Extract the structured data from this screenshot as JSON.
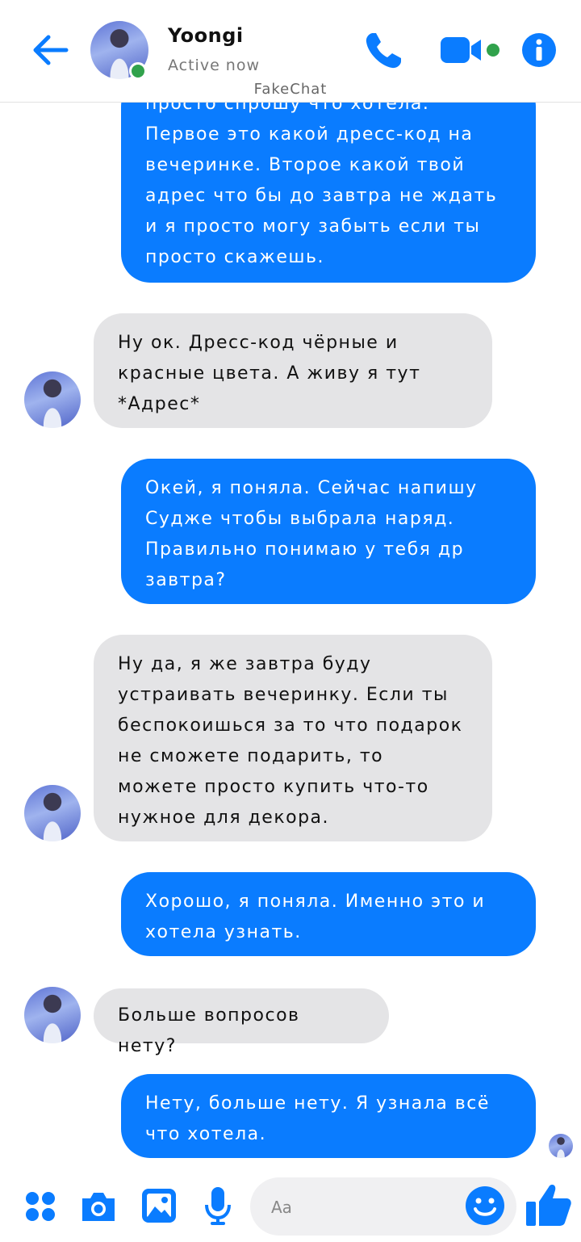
{
  "header": {
    "contact_name": "Yoongi",
    "status": "Active now",
    "watermark": "FakeChat",
    "icons": [
      "back-arrow-icon",
      "phone-icon",
      "video-camera-icon",
      "info-icon"
    ]
  },
  "messages": [
    {
      "from": "me",
      "text": "просто спрошу что хотела.\nПервое это какой дресс-код на вечеринке. Второе какой твой адрес что бы до завтра не ждать и я просто могу забыть если ты просто скажешь."
    },
    {
      "from": "them",
      "text": "Ну ок. Дресс-код чёрные и красные цвета. А живу я тут *Адрес*"
    },
    {
      "from": "me",
      "text": "Окей, я поняла. Сейчас напишу Судже чтобы выбрала наряд. Правильно понимаю у тебя др завтра?"
    },
    {
      "from": "them",
      "text": "Ну да, я же завтра буду устраивать вечеринку. Если ты беспокоишься за то что подарок не сможете подарить, то можете просто купить что-то нужное для декора."
    },
    {
      "from": "me",
      "text": "Хорошо, я поняла. Именно это и хотела узнать."
    },
    {
      "from": "them",
      "text": "Больше вопросов нету?"
    },
    {
      "from": "me",
      "text": "Нету, больше нету. Я узнала всё что хотела."
    }
  ],
  "composer": {
    "placeholder": "Aa",
    "icons": [
      "menu-dots-icon",
      "camera-icon",
      "gallery-icon",
      "microphone-icon",
      "emoji-icon",
      "thumbs-up-icon"
    ]
  },
  "colors": {
    "accent": "#0a7cff",
    "received_bubble": "#e4e4e6",
    "online": "#31a24c"
  }
}
